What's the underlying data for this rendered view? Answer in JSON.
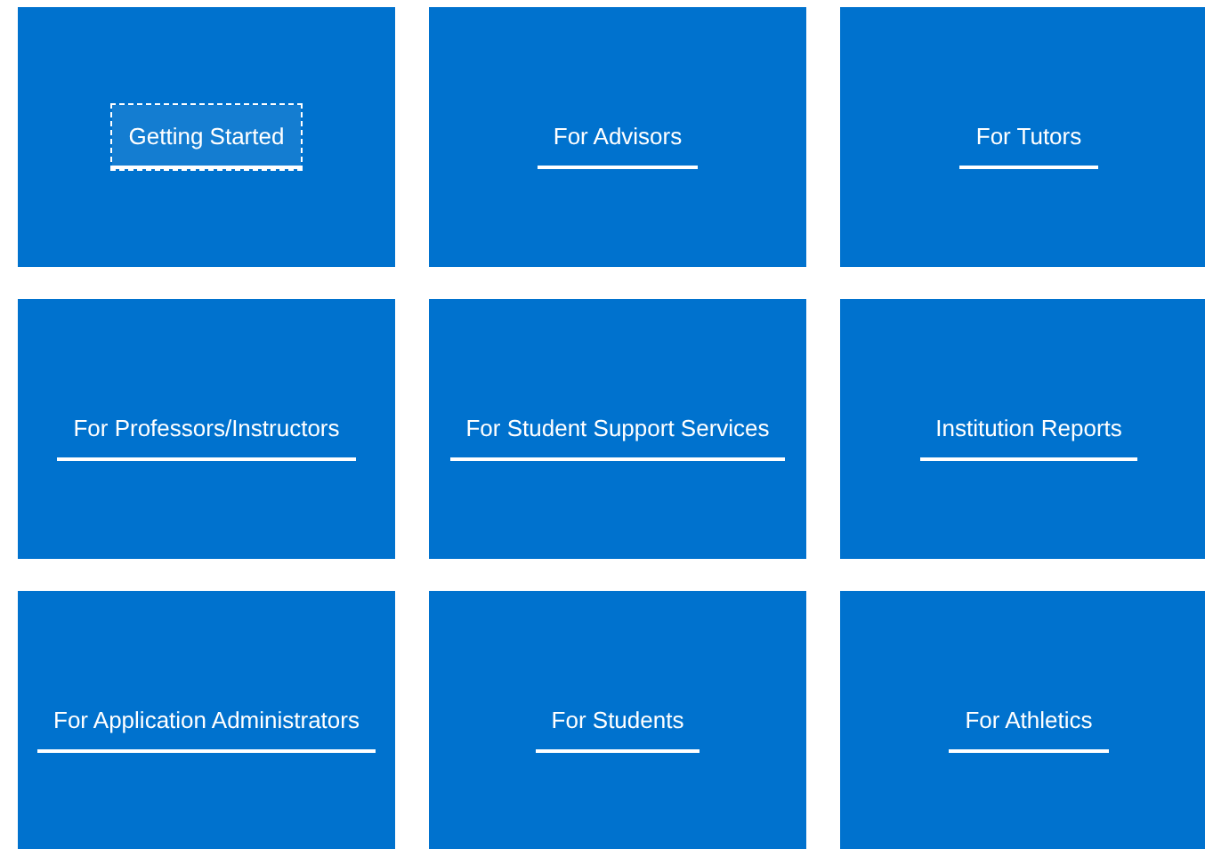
{
  "tiles": [
    {
      "label": "Getting Started",
      "focused": true
    },
    {
      "label": "For Advisors",
      "focused": false
    },
    {
      "label": "For Tutors",
      "focused": false
    },
    {
      "label": "For Professors/Instructors",
      "focused": false
    },
    {
      "label": "For Student Support Services",
      "focused": false
    },
    {
      "label": "Institution Reports",
      "focused": false
    },
    {
      "label": "For Application Administrators",
      "focused": false
    },
    {
      "label": "For Students",
      "focused": false
    },
    {
      "label": "For Athletics",
      "focused": false
    }
  ]
}
